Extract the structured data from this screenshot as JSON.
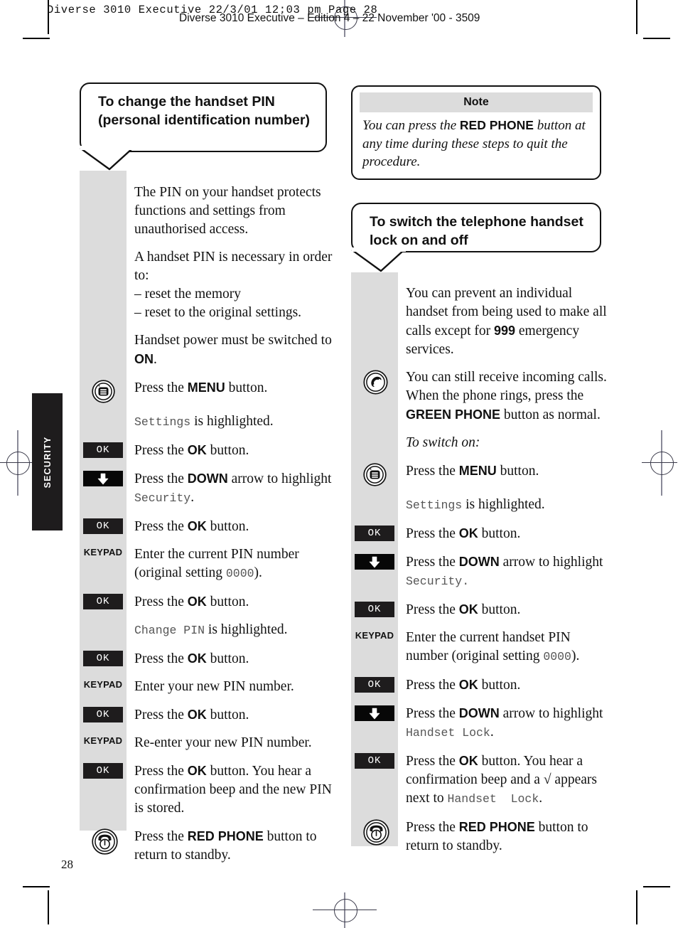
{
  "print_header": {
    "slug": "Diverse 3010 Executive   22/3/01   12:03 pm   Page 28",
    "edition": "Diverse 3010 Executive – Edition 4 – 22 November '00 - 3509"
  },
  "side_tab": {
    "label": "SECURITY"
  },
  "page_number": "28",
  "left_column": {
    "heading": "To change the handset PIN (personal identification number)",
    "rows": [
      {
        "icon": "none",
        "text_html": "The PIN on your handset protects functions and settings from unauthorised access."
      },
      {
        "icon": "none",
        "text_html": "A handset PIN is necessary in order to:<br>– reset the memory<br>– reset to the original settings."
      },
      {
        "icon": "none",
        "text_html": "Handset power must be switched to <b>ON</b>."
      },
      {
        "icon": "menu-button-icon",
        "text_html": "Press the <b>MENU</b> button."
      },
      {
        "icon": "none",
        "text_html": "<span class=\"lcd\">Settings</span> is highlighted."
      },
      {
        "icon": "ok-key",
        "icon_label": "OK",
        "text_html": "Press the <b>OK</b> button."
      },
      {
        "icon": "down-arrow-key",
        "text_html": "Press the <b>DOWN</b> arrow to highlight <span class=\"lcd\">Security</span>."
      },
      {
        "icon": "ok-key",
        "icon_label": "OK",
        "text_html": "Press the <b>OK</b> button."
      },
      {
        "icon": "keypad-label",
        "icon_label": "KEYPAD",
        "text_html": "Enter the current PIN number (original setting <span class=\"lcd\">0000</span>)."
      },
      {
        "icon": "ok-key",
        "icon_label": "OK",
        "text_html": "Press the <b>OK</b> button."
      },
      {
        "icon": "none",
        "text_html": "<span class=\"lcd\">Change PIN</span> is highlighted."
      },
      {
        "icon": "ok-key",
        "icon_label": "OK",
        "text_html": "Press the <b>OK</b> button."
      },
      {
        "icon": "keypad-label",
        "icon_label": "KEYPAD",
        "text_html": "Enter your new PIN number."
      },
      {
        "icon": "ok-key",
        "icon_label": "OK",
        "text_html": "Press the <b>OK</b> button."
      },
      {
        "icon": "keypad-label",
        "icon_label": "KEYPAD",
        "text_html": "Re-enter your new PIN number."
      },
      {
        "icon": "ok-key",
        "icon_label": "OK",
        "text_html": "Press the <b>OK</b> button. You hear a confirmation beep and the new PIN is stored."
      },
      {
        "icon": "red-phone-icon",
        "text_html": "Press the <b>RED PHONE</b> button to return to standby."
      }
    ]
  },
  "note": {
    "title": "Note",
    "body_html": "You can press the <b>RED PHONE</b> button at any time during these steps to quit the procedure."
  },
  "right_column": {
    "heading": "To switch the telephone handset lock on and off",
    "rows": [
      {
        "icon": "none",
        "text_html": "You can prevent an individual handset from being used to make all calls except for <b>999</b> emergency services."
      },
      {
        "icon": "green-phone-icon",
        "text_html": "You can still receive incoming calls. When the phone rings, press the <b>GREEN PHONE</b> button as normal."
      },
      {
        "icon": "none",
        "text_html": "<span class=\"ital\">To switch on:</span>"
      },
      {
        "icon": "menu-button-icon",
        "text_html": "Press the <b>MENU</b> button."
      },
      {
        "icon": "none",
        "text_html": "<span class=\"lcd\">Settings</span> is highlighted."
      },
      {
        "icon": "ok-key",
        "icon_label": "OK",
        "text_html": "Press the <b>OK</b> button."
      },
      {
        "icon": "down-arrow-key",
        "text_html": "Press the <b>DOWN</b> arrow to highlight <span class=\"lcd\">Security.</span>"
      },
      {
        "icon": "ok-key",
        "icon_label": "OK",
        "text_html": "Press the <b>OK</b> button."
      },
      {
        "icon": "keypad-label",
        "icon_label": "KEYPAD",
        "text_html": "Enter the current handset PIN number (original setting <span class=\"lcd\">0000</span>)."
      },
      {
        "icon": "ok-key",
        "icon_label": "OK",
        "text_html": "Press the <b>OK</b> button."
      },
      {
        "icon": "down-arrow-key",
        "text_html": "Press the <b>DOWN</b> arrow to highlight <span class=\"lcd\">Handset Lock</span>."
      },
      {
        "icon": "ok-key",
        "icon_label": "OK",
        "text_html": "Press the <b>OK</b> button. You hear a confirmation beep and a &#8730; appears next to <span class=\"lcd\">Handset&nbsp;&nbsp;Lock</span>."
      },
      {
        "icon": "red-phone-icon",
        "text_html": "Press the <b>RED PHONE</b> button to return to standby."
      }
    ]
  },
  "colors": {
    "gutter_grey": "#dcdcdc",
    "key_black": "#1e1c1d",
    "ink": "#111111"
  }
}
